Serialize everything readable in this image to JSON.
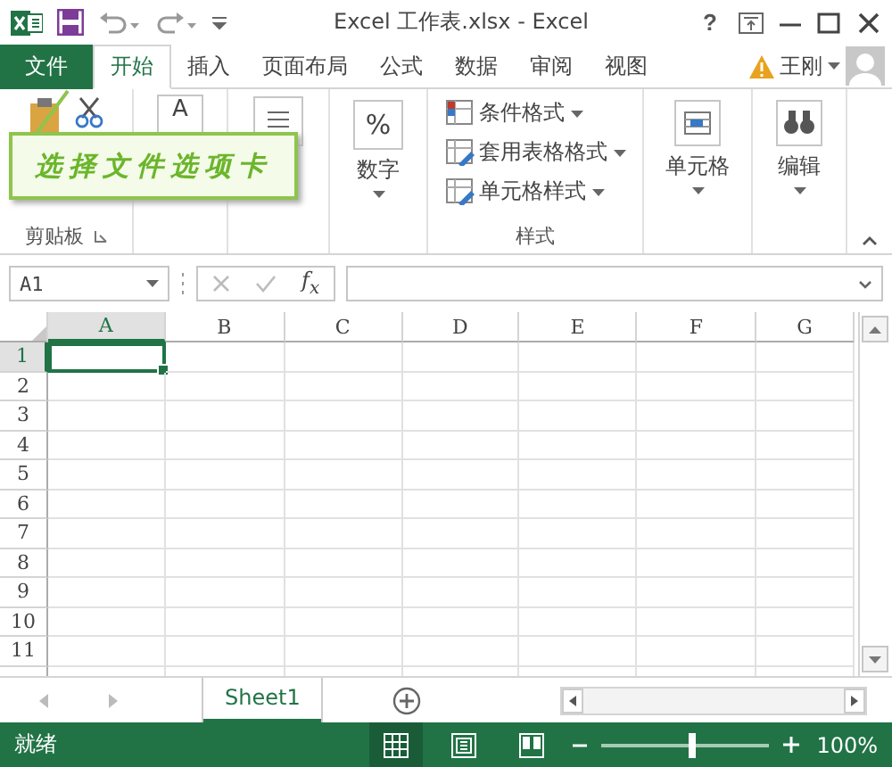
{
  "title_bar": {
    "title": "Excel 工作表.xlsx - Excel",
    "help": "?"
  },
  "tabs": [
    {
      "label": "文件",
      "kind": "file",
      "selected": false
    },
    {
      "label": "开始",
      "kind": "tab",
      "selected": true
    },
    {
      "label": "插入",
      "kind": "tab",
      "selected": false
    },
    {
      "label": "页面布局",
      "kind": "tab",
      "selected": false
    },
    {
      "label": "公式",
      "kind": "tab",
      "selected": false
    },
    {
      "label": "数据",
      "kind": "tab",
      "selected": false
    },
    {
      "label": "审阅",
      "kind": "tab",
      "selected": false
    },
    {
      "label": "视图",
      "kind": "tab",
      "selected": false
    }
  ],
  "user": {
    "name": "王刚"
  },
  "ribbon": {
    "groups": [
      {
        "kind": "clipboard",
        "label": "剪贴板"
      },
      {
        "kind": "font",
        "glyph": "A"
      },
      {
        "kind": "alignment"
      },
      {
        "kind": "number",
        "glyph": "%",
        "label": "数字"
      },
      {
        "kind": "styles",
        "label": "样式",
        "items": [
          "条件格式",
          "套用表格格式",
          "单元格样式"
        ]
      },
      {
        "kind": "cells",
        "label": "单元格"
      },
      {
        "kind": "editing",
        "label": "编辑"
      }
    ]
  },
  "callout": {
    "text": "选择文件选项卡"
  },
  "formula_bar": {
    "name_box": "A1",
    "function_button": "f$_{x}$"
  },
  "sheet": {
    "columns": [
      {
        "label": "A",
        "selected": true
      },
      {
        "label": "B",
        "selected": false
      },
      {
        "label": "C",
        "selected": false
      },
      {
        "label": "D",
        "selected": false
      },
      {
        "label": "E",
        "selected": false
      },
      {
        "label": "F",
        "selected": false
      },
      {
        "label": "G",
        "selected": false
      }
    ],
    "rows": [
      {
        "label": "1",
        "selected": true
      },
      {
        "label": "2",
        "selected": false
      },
      {
        "label": "3",
        "selected": false
      },
      {
        "label": "4",
        "selected": false
      },
      {
        "label": "5",
        "selected": false
      },
      {
        "label": "6",
        "selected": false
      },
      {
        "label": "7",
        "selected": false
      },
      {
        "label": "8",
        "selected": false
      },
      {
        "label": "9",
        "selected": false
      },
      {
        "label": "10",
        "selected": false
      },
      {
        "label": "11",
        "selected": false
      }
    ]
  },
  "sheet_tabs": [
    {
      "label": "Sheet1",
      "selected": true
    }
  ],
  "status_bar": {
    "text": "就绪",
    "views": [
      {
        "kind": "normal",
        "selected": true
      },
      {
        "kind": "page_layout",
        "selected": false
      },
      {
        "kind": "page_break",
        "selected": false
      }
    ],
    "zoom": {
      "level": 0.55,
      "reading": "100%"
    }
  }
}
